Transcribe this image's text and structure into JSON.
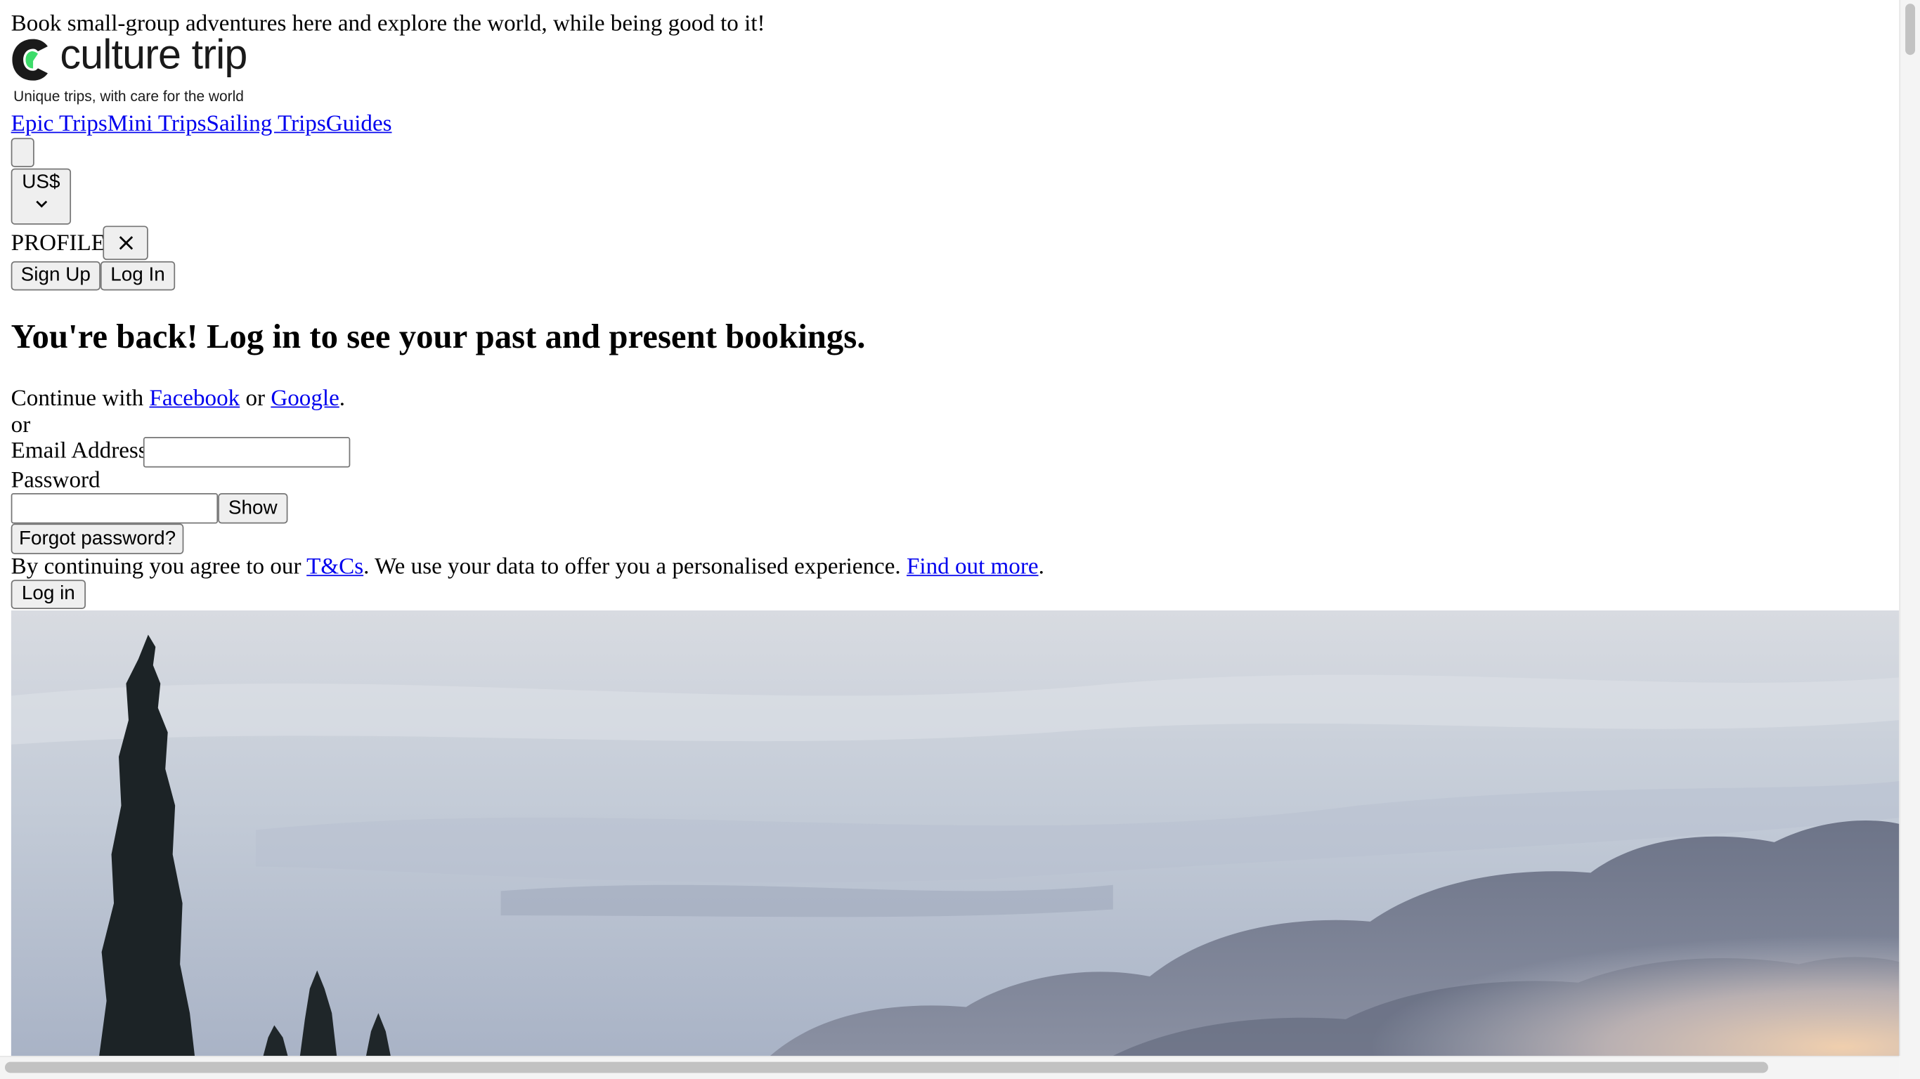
{
  "banner": {
    "text": "Book small-group adventures here and explore the world, while being good to it!"
  },
  "logo": {
    "name": "culture trip",
    "tagline": "Unique trips, with care for the world"
  },
  "nav": {
    "items": [
      "Epic Trips",
      "Mini Trips",
      "Sailing Trips",
      "Guides"
    ]
  },
  "currency": {
    "label": "US$"
  },
  "profile": {
    "label": "PROFILE",
    "close_icon": "close-icon"
  },
  "auth_tabs": {
    "sign_up": "Sign Up",
    "log_in": "Log In"
  },
  "login": {
    "heading": "You're back! Log in to see your past and present bookings.",
    "continue_prefix": "Continue with ",
    "facebook": "Facebook",
    "or_mid": " or ",
    "google": "Google",
    "period": ".",
    "or_separator": "or",
    "email_label": "Email Address",
    "email_value": "",
    "password_label": "Password",
    "password_value": "",
    "show_button": "Show",
    "forgot_button": "Forgot password?",
    "terms_prefix": "By continuing you agree to our ",
    "terms_link": "T&Cs",
    "terms_middle": ". We use your data to offer you a personalised experience. ",
    "find_out_link": "Find out more",
    "terms_suffix": ".",
    "submit_button": "Log in"
  },
  "colors": {
    "link": "#0000ee",
    "logo_green": "#3ddc6a",
    "button_bg": "#efefef",
    "button_border": "#767676"
  }
}
